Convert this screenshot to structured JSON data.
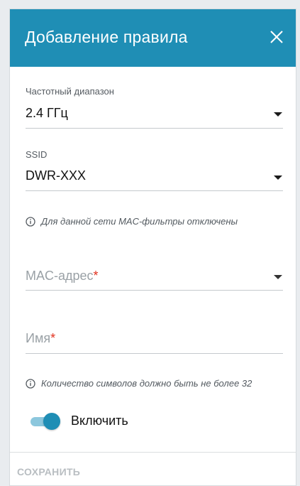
{
  "dialog": {
    "title": "Добавление правила",
    "close_icon": "close-icon",
    "header_color": "#1f8eb5"
  },
  "band": {
    "label": "Частотный диапазон",
    "value": "2.4 ГГц"
  },
  "ssid": {
    "label": "SSID",
    "value": "DWR-XXX"
  },
  "ssid_hint": "Для данной сети MAC-фильтры отключены",
  "mac": {
    "placeholder": "MAC-адрес",
    "required_mark": "*"
  },
  "name": {
    "placeholder": "Имя",
    "required_mark": "*"
  },
  "name_hint": "Количество символов должно быть не более 32",
  "enable": {
    "label": "Включить",
    "on": true
  },
  "actions": {
    "save_label": "СОХРАНИТЬ"
  }
}
